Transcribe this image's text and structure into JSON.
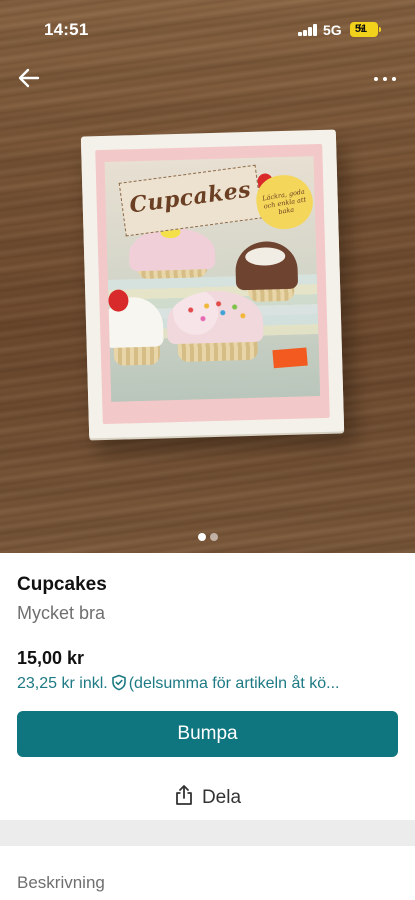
{
  "status_bar": {
    "time": "14:51",
    "network": "5G",
    "battery": "51"
  },
  "photo": {
    "book_title": "Cupcakes",
    "book_subtitle": "Läckra, goda och enkla att baka",
    "pagination": {
      "total": 2,
      "current": 1
    }
  },
  "item": {
    "title": "Cupcakes",
    "condition": "Mycket bra",
    "price": "15,00 kr",
    "price_incl": "23,25 kr inkl.",
    "price_incl_note": "(delsumma för artikeln åt kö..."
  },
  "actions": {
    "bump_label": "Bumpa",
    "share_label": "Dela"
  },
  "description": {
    "heading": "Beskrivning"
  },
  "colors": {
    "accent": "#0f7680",
    "link": "#1e7a84"
  }
}
